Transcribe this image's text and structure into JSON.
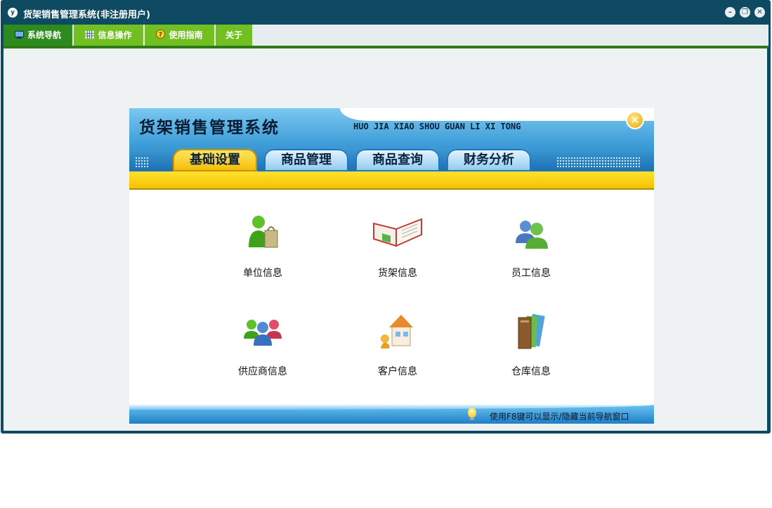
{
  "window": {
    "title": "货架销售管理系统(非注册用户)",
    "app_icon_glyph": "y",
    "min_glyph": "–",
    "restore_glyph": "❐",
    "close_glyph": "✕"
  },
  "menu": {
    "items": [
      {
        "label": "系统导航",
        "icon": "monitor-icon",
        "active": true
      },
      {
        "label": "信息操作",
        "icon": "grid-icon"
      },
      {
        "label": "使用指南",
        "icon": "help-icon"
      },
      {
        "label": "关于"
      }
    ]
  },
  "panel": {
    "title": "货架销售管理系统",
    "pinyin": "HUO JIA XIAO SHOU GUAN LI XI TONG",
    "close_glyph": "✕",
    "tabs": [
      {
        "label": "基础设置",
        "active": true
      },
      {
        "label": "商品管理"
      },
      {
        "label": "商品查询"
      },
      {
        "label": "财务分析"
      }
    ],
    "items": [
      {
        "label": "单位信息",
        "icon": "unit-person-bag-icon"
      },
      {
        "label": "货架信息",
        "icon": "open-book-icon"
      },
      {
        "label": "员工信息",
        "icon": "employees-icon"
      },
      {
        "label": "供应商信息",
        "icon": "supplier-group-icon"
      },
      {
        "label": "客户信息",
        "icon": "customer-house-icon"
      },
      {
        "label": "仓库信息",
        "icon": "warehouse-books-icon"
      }
    ],
    "footer_tip": "使用F8键可以显示/隐藏当前导航窗口"
  },
  "colors": {
    "window_frame": "#0f4a63",
    "menu_green": "#72bf21",
    "menu_active": "#2d8a1c",
    "banner_blue": "#3a9ad6",
    "tab_yellow": "#f3bb05"
  }
}
